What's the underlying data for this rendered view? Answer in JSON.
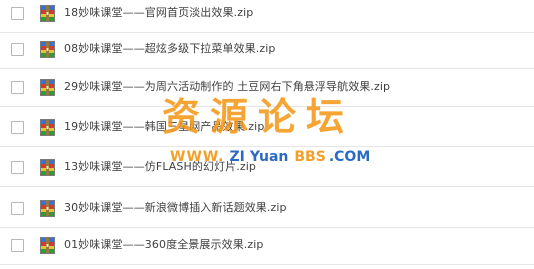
{
  "files": [
    {
      "name": "18妙味课堂——官网首页淡出效果.zip",
      "icon": "zip-archive-icon"
    },
    {
      "name": "08妙味课堂——超炫多级下拉菜单效果.zip",
      "icon": "zip-archive-icon"
    },
    {
      "name": "29妙味课堂——为周六活动制作的 土豆网右下角悬浮导航效果.zip",
      "icon": "zip-archive-icon"
    },
    {
      "name": "19妙味课堂——韩国三星网产品效果.zip",
      "icon": "zip-archive-icon"
    },
    {
      "name": "13妙味课堂——仿FLASH的幻灯片.zip",
      "icon": "zip-archive-icon"
    },
    {
      "name": "30妙味课堂——新浪微博插入新话题效果.zip",
      "icon": "zip-archive-icon"
    },
    {
      "name": "01妙味课堂——360度全景展示效果.zip",
      "icon": "zip-archive-icon"
    }
  ],
  "watermark": {
    "title": "资源论坛",
    "www": "WWW.",
    "zi": "ZI",
    "yuan": "Yuan",
    "bbs": "BBS",
    "com": ".COM"
  },
  "colors": {
    "watermark_orange": "#f59614",
    "watermark_blue": "#145abe",
    "text": "#3f3f3f",
    "row_border": "#e6e6e6"
  }
}
